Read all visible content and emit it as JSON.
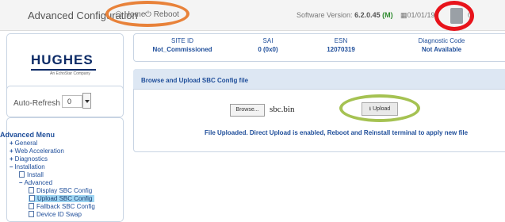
{
  "header": {
    "title": "Advanced Configuration",
    "home_label": "Home",
    "reboot_label": "Reboot",
    "software_version_label": "Software Version:",
    "software_version_value": "6.2.0.45",
    "software_version_suffix": "(M)",
    "date_text": "01/01/197",
    "time_tail": "0"
  },
  "sidebar": {
    "logo_text": "HUGHES",
    "logo_subtitle": "An EchoStar Company",
    "auto_refresh_label": "Auto-Refresh",
    "auto_refresh_value": "0",
    "menu_title": "Advanced Menu",
    "menu": {
      "general": "General",
      "web_acceleration": "Web Acceleration",
      "diagnostics": "Diagnostics",
      "installation": "Installation",
      "install": "Install",
      "advanced": "Advanced",
      "display_sbc_config": "Display SBC Config",
      "upload_sbc_config": "Upload SBC Config",
      "fallback_sbc_config": "Fallback SBC Config",
      "device_id_swap": "Device ID Swap"
    }
  },
  "info": {
    "site_id_label": "SITE ID",
    "site_id_value": "Not_Commissioned",
    "sai_label": "SAI",
    "sai_value": "0 (0x0)",
    "esn_label": "ESN",
    "esn_value": "12070319",
    "diag_label": "Diagnostic Code",
    "diag_value": "Not Available"
  },
  "upload_panel": {
    "title": "Browse and Upload SBC Config file",
    "browse_label": "Browse...",
    "file_name": "sbc.bin",
    "upload_label": "Upload",
    "status_message": "File Uploaded. Direct Upload is enabled, Reboot and Reinstall terminal to apply new file"
  },
  "icons": {
    "home": "home-icon",
    "reboot": "power-icon",
    "calendar": "calendar-icon",
    "upload": "upload-icon"
  },
  "colors": {
    "annotation_orange": "#e8823a",
    "annotation_red": "#e8131b",
    "annotation_green": "#a5c252",
    "brand_navy": "#0b2a66",
    "link_blue": "#1f4e9a",
    "selected_bg": "#9fd6f3"
  }
}
